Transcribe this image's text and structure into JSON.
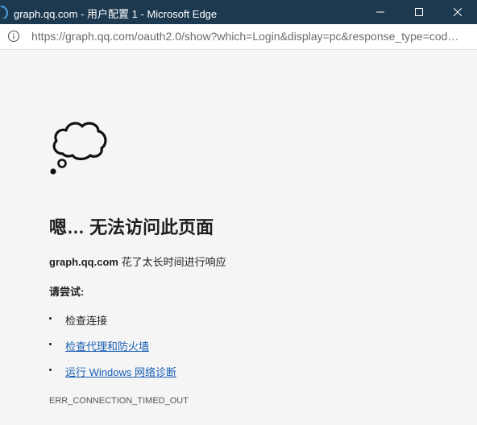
{
  "window": {
    "title": "graph.qq.com - 用户配置 1 - Microsoft Edge",
    "controls": {
      "minimize": "minimize-icon",
      "maximize": "maximize-icon",
      "close": "close-icon"
    }
  },
  "addressbar": {
    "url": "https://graph.qq.com/oauth2.0/show?which=Login&display=pc&response_type=cod…",
    "info_icon": "info-icon"
  },
  "error": {
    "icon": "thought-cloud-icon",
    "heading": "嗯… 无法访问此页面",
    "host": "graph.qq.com",
    "message": "花了太长时间进行响应",
    "try_label": "请尝试:",
    "suggestions": [
      {
        "text": "检查连接",
        "link": false
      },
      {
        "text": "检查代理和防火墙",
        "link": true
      },
      {
        "text": "运行 Windows 网络诊断",
        "link": true
      }
    ],
    "code": "ERR_CONNECTION_TIMED_OUT"
  },
  "colors": {
    "titlebar": "#1c3950",
    "link": "#1a5fb4",
    "background": "#f5f5f5"
  }
}
